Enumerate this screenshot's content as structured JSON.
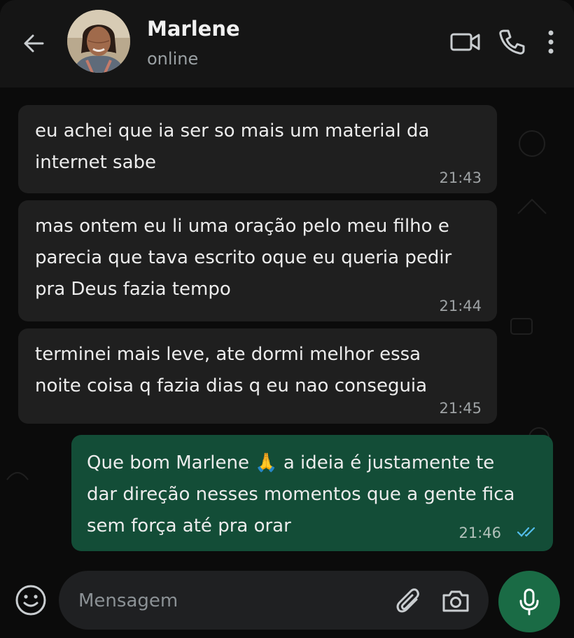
{
  "header": {
    "contact_name": "Marlene",
    "status": "online",
    "icons": {
      "back": "arrow-left-icon",
      "video": "video-call-icon",
      "call": "phone-icon",
      "menu": "more-vertical-icon"
    }
  },
  "messages": [
    {
      "direction": "incoming",
      "lines": [
        "eu achei que ia ser so mais um material da",
        "internet sabe"
      ],
      "time": "21:43"
    },
    {
      "direction": "incoming",
      "lines": [
        "mas ontem eu li uma oração pelo meu filho e",
        "parecia que tava escrito oque eu queria pedir",
        "pra Deus fazia tempo"
      ],
      "time": "21:44"
    },
    {
      "direction": "incoming",
      "lines": [
        "terminei mais leve, ate dormi melhor essa",
        "noite coisa q fazia dias q eu nao conseguia"
      ],
      "time": "21:45"
    },
    {
      "direction": "outgoing",
      "lines": [
        "Que bom Marlene 🙏 a ideia é justamente te",
        "dar direção nesses momentos que a gente fica",
        "sem força até pra orar"
      ],
      "time": "21:46",
      "status": "read"
    }
  ],
  "composer": {
    "placeholder": "Mensagem",
    "value": ""
  },
  "colors": {
    "incoming_bubble": "#1f1f1f",
    "outgoing_bubble": "#134d37",
    "mic_button": "#1a6b45",
    "read_ticks": "#53bdeb"
  }
}
